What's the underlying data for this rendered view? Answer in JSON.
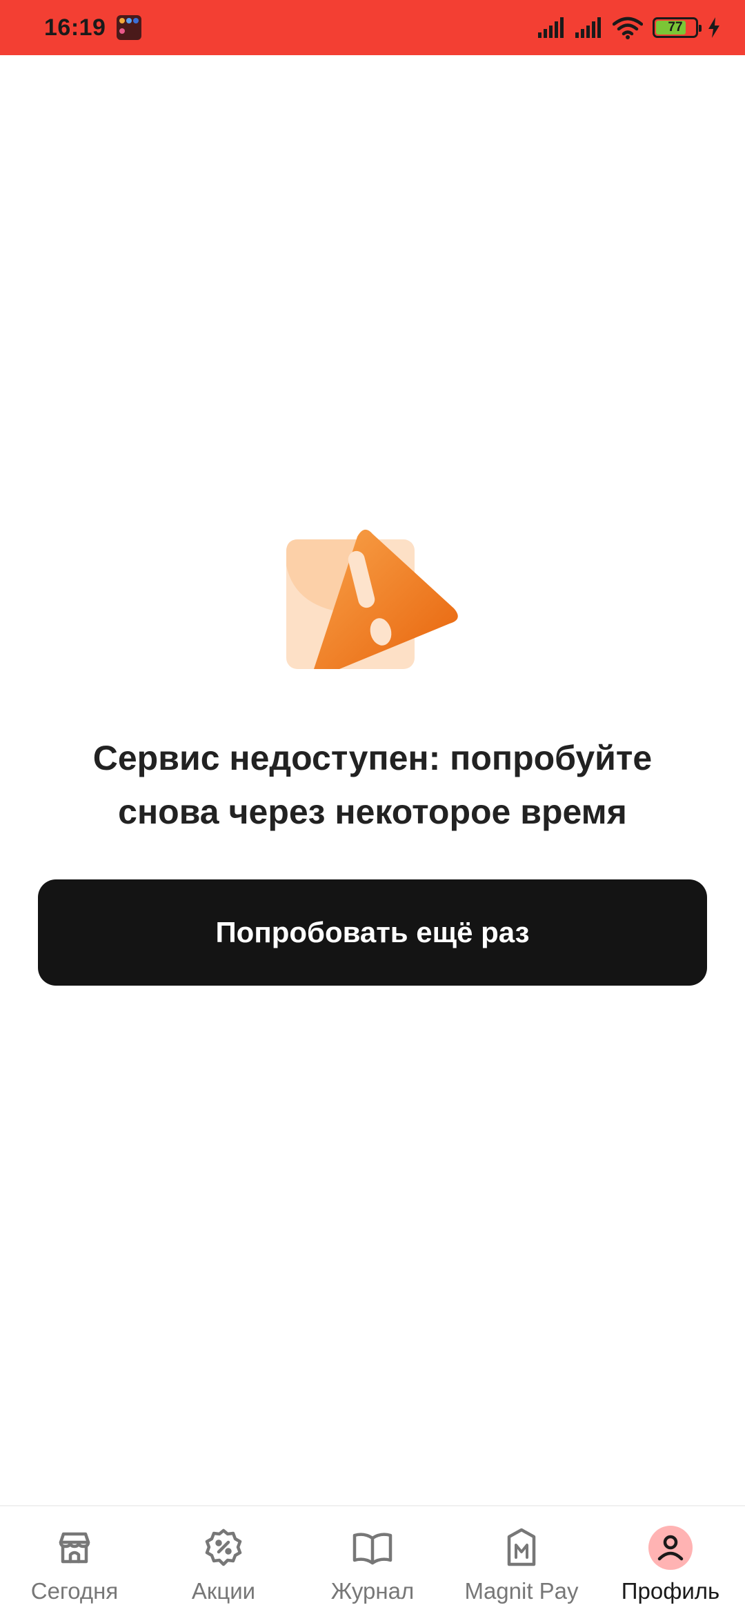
{
  "status_bar": {
    "time": "16:19",
    "battery_level": "77",
    "background_color": "#f33f33"
  },
  "error": {
    "message_line1": "Сервис недоступен: попробуйте",
    "message_line2": "снова через некоторое время",
    "icon": "warning-triangle-icon",
    "icon_color": "#ef7b1d"
  },
  "retry_button": {
    "label": "Попробовать ещё раз"
  },
  "bottom_nav": {
    "items": [
      {
        "label": "Сегодня",
        "icon": "storefront-icon",
        "active": false
      },
      {
        "label": "Акции",
        "icon": "discount-badge-icon",
        "active": false
      },
      {
        "label": "Журнал",
        "icon": "open-book-icon",
        "active": false
      },
      {
        "label": "Magnit Pay",
        "icon": "magnit-pay-icon",
        "active": false
      },
      {
        "label": "Профиль",
        "icon": "profile-icon",
        "active": true
      }
    ],
    "active_color": "#ffb3b3"
  }
}
